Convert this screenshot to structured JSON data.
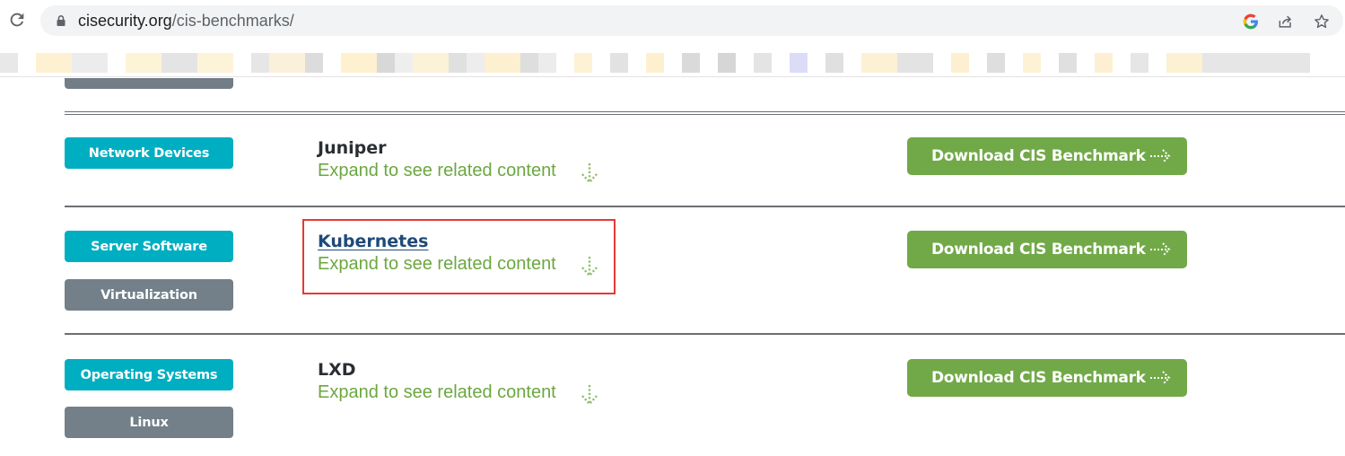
{
  "browser": {
    "url_host": "cisecurity.org",
    "url_path": "/cis-benchmarks/"
  },
  "benchmarks": [
    {
      "tags": [
        {
          "label": "Network Devices",
          "color": "teal"
        }
      ],
      "title": "Juniper",
      "expand_text": "Expand to see related content",
      "button_label": "Download CIS Benchmark"
    },
    {
      "tags": [
        {
          "label": "Server Software",
          "color": "teal"
        },
        {
          "label": "Virtualization",
          "color": "gray"
        }
      ],
      "title": "Kubernetes",
      "expand_text": "Expand to see related content",
      "button_label": "Download CIS Benchmark"
    },
    {
      "tags": [
        {
          "label": "Operating Systems",
          "color": "teal"
        },
        {
          "label": "Linux",
          "color": "gray"
        }
      ],
      "title": "LXD",
      "expand_text": "Expand to see related content",
      "button_label": "Download CIS Benchmark"
    }
  ],
  "colors": {
    "teal_tag": "#00aec1",
    "gray_tag": "#738089",
    "download_button": "#72a948",
    "expand_text": "#6ba740",
    "highlight_box": "#e53935"
  },
  "icons": {
    "reload": "reload-icon",
    "lock": "lock-icon",
    "google": "google-icon",
    "share": "share-icon",
    "bookmark": "star-icon",
    "expand": "arrow-down-icon",
    "download": "arrow-right-icon"
  }
}
